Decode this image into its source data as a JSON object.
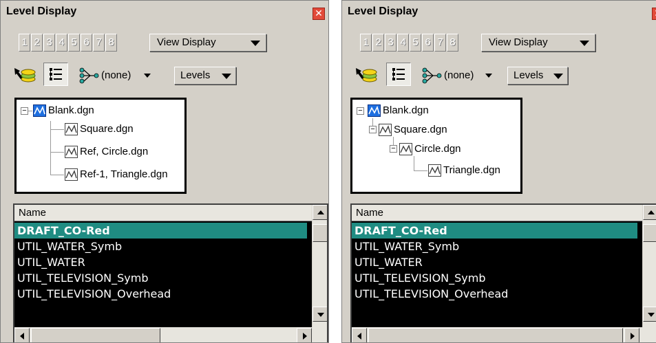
{
  "colors": {
    "panel_bg": "#d4d0c8",
    "selected_row": "#1f8c82",
    "list_bg": "#000000",
    "close_button": "#e24a3a"
  },
  "panels": [
    {
      "title": "Level Display",
      "level_tabs": [
        "1",
        "2",
        "3",
        "4",
        "5",
        "6",
        "7",
        "8"
      ],
      "view_display_label": "View Display",
      "filter_label": "(none)",
      "levels_label": "Levels",
      "tree": [
        {
          "label": "Blank.dgn",
          "depth": 0,
          "expander": "−",
          "icon": "root-model-icon"
        },
        {
          "label": "Square.dgn",
          "depth": 1,
          "expander": "",
          "icon": "model-icon"
        },
        {
          "label": "Ref, Circle.dgn",
          "depth": 1,
          "expander": "",
          "icon": "model-icon"
        },
        {
          "label": "Ref-1, Triangle.dgn",
          "depth": 1,
          "expander": "",
          "icon": "model-icon"
        }
      ],
      "list_header": "Name",
      "list_rows": [
        "DRAFT_CO-Red",
        "UTIL_WATER_Symb",
        "UTIL_WATER",
        "UTIL_TELEVISION_Symb",
        "UTIL_TELEVISION_Overhead"
      ],
      "selected_row": 0
    },
    {
      "title": "Level Display",
      "level_tabs": [
        "1",
        "2",
        "3",
        "4",
        "5",
        "6",
        "7",
        "8"
      ],
      "view_display_label": "View Display",
      "filter_label": "(none)",
      "levels_label": "Levels",
      "tree": [
        {
          "label": "Blank.dgn",
          "depth": 0,
          "expander": "−",
          "icon": "root-model-icon"
        },
        {
          "label": "Square.dgn",
          "depth": 1,
          "expander": "−",
          "icon": "model-icon"
        },
        {
          "label": "Circle.dgn",
          "depth": 2,
          "expander": "−",
          "icon": "model-icon"
        },
        {
          "label": "Triangle.dgn",
          "depth": 3,
          "expander": "",
          "icon": "model-icon"
        }
      ],
      "list_header": "Name",
      "list_rows": [
        "DRAFT_CO-Red",
        "UTIL_WATER_Symb",
        "UTIL_WATER",
        "UTIL_TELEVISION_Symb",
        "UTIL_TELEVISION_Overhead"
      ],
      "selected_row": 0
    }
  ]
}
